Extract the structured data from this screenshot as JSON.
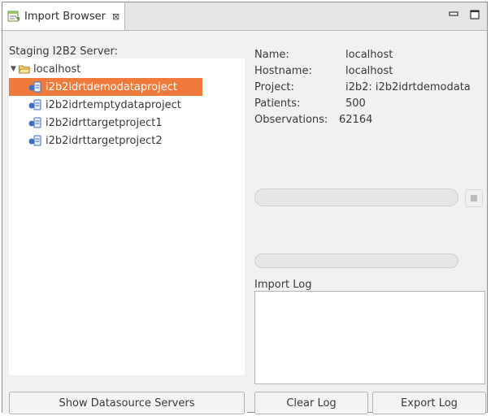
{
  "view": {
    "tab_title": "Import Browser",
    "tab_close_glyph": "⊠"
  },
  "left": {
    "staging_label": "Staging I2B2 Server:",
    "tree": {
      "root": "localhost",
      "projects": [
        {
          "name": "i2b2idrtdemodataproject",
          "selected": true
        },
        {
          "name": "i2b2idrtemptydataproject",
          "selected": false
        },
        {
          "name": "i2b2idrttargetproject1",
          "selected": false
        },
        {
          "name": "i2b2idrttargetproject2",
          "selected": false
        }
      ]
    },
    "show_servers_label": "Show Datasource Servers"
  },
  "details": {
    "name_label": "Name:",
    "name_value": "localhost",
    "hostname_label": "Hostname:",
    "hostname_value": "localhost",
    "project_label": "Project:",
    "project_value": "i2b2: i2b2idrtdemodata",
    "patients_label": "Patients:",
    "patients_value": "500",
    "observations_label": "Observations:",
    "observations_value": "62164"
  },
  "log": {
    "label": "Import Log",
    "clear_label": "Clear Log",
    "export_label": "Export Log"
  },
  "colors": {
    "selection": "#ef7a3c",
    "panel_bg": "#f2f1f0",
    "accent_blue": "#3b6fc4"
  },
  "icons": {
    "tab": "import-browser-icon",
    "folder": "folder-open-icon",
    "project": "database-project-icon",
    "stop": "stop-icon"
  }
}
